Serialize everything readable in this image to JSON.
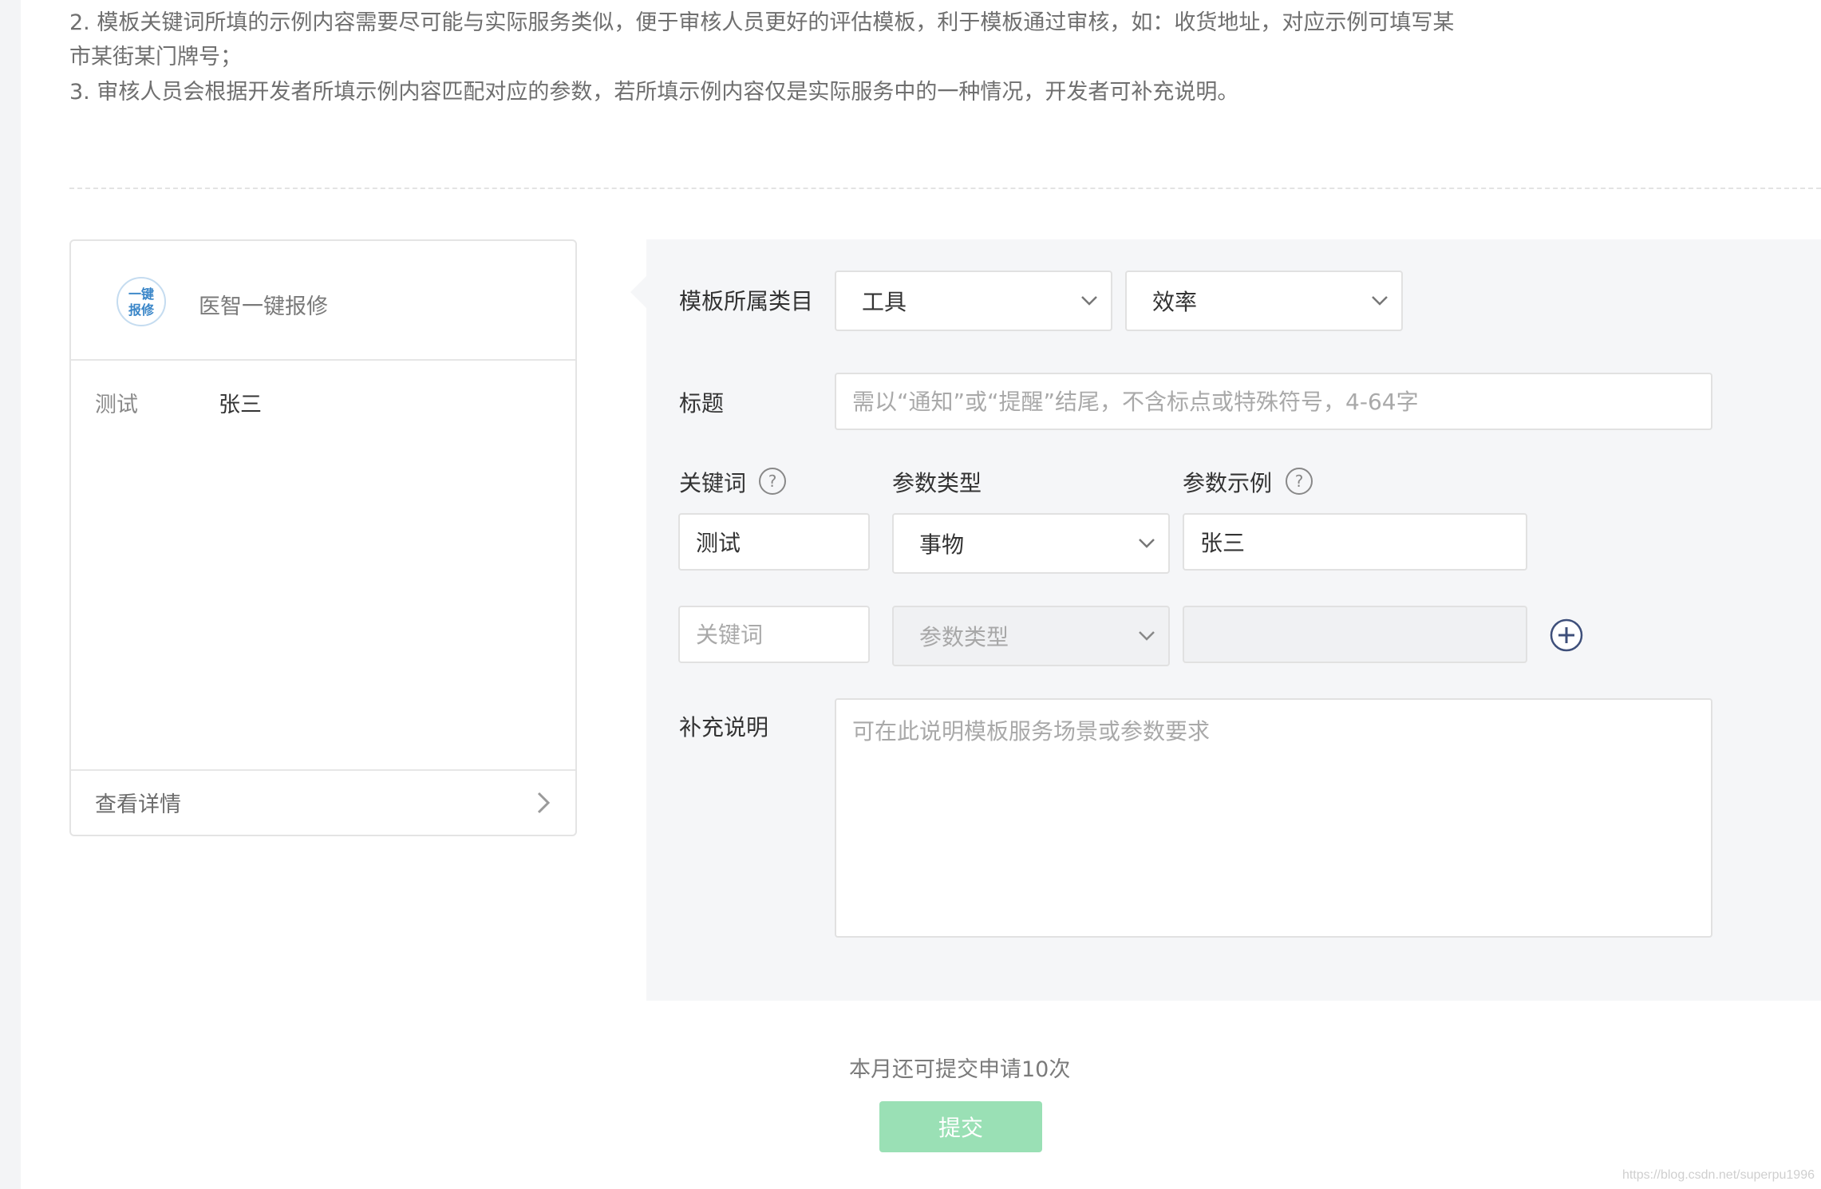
{
  "notes": [
    "2. 模板关键词所填的示例内容需要尽可能与实际服务类似，便于审核人员更好的评估模板，利于模板通过审核，如：收货地址，对应示例可填写某",
    "市某街某门牌号；",
    "3. 审核人员会根据开发者所填示例内容匹配对应的参数，若所填示例内容仅是实际服务中的一种情况，开发者可补充说明。"
  ],
  "preview": {
    "logo_text_top": "一键",
    "logo_text_bottom": "报修",
    "app_name": "医智一键报修",
    "row_key": "测试",
    "row_value": "张三",
    "detail_link": "查看详情"
  },
  "form": {
    "category_label": "模板所属类目",
    "category_primary": "工具",
    "category_secondary": "效率",
    "title_label": "标题",
    "title_placeholder": "需以“通知”或“提醒”结尾，不含标点或特殊符号，4-64字",
    "keyword_header": "关键词",
    "type_header": "参数类型",
    "example_header": "参数示例",
    "rows": [
      {
        "keyword": "测试",
        "type": "事物",
        "example": "张三"
      }
    ],
    "new_row": {
      "keyword_placeholder": "关键词",
      "type_placeholder": "参数类型",
      "example": ""
    },
    "extra_label": "补充说明",
    "extra_placeholder": "可在此说明模板服务场景或参数要求"
  },
  "footer": {
    "quota_text": "本月还可提交申请10次",
    "submit_label": "提交"
  },
  "watermark": "https://blog.csdn.net/superpu1996",
  "colors": {
    "submit_disabled": "#9ae0b5",
    "panel_bg": "#f5f6f8",
    "accent_icon": "#3e4f7a"
  }
}
